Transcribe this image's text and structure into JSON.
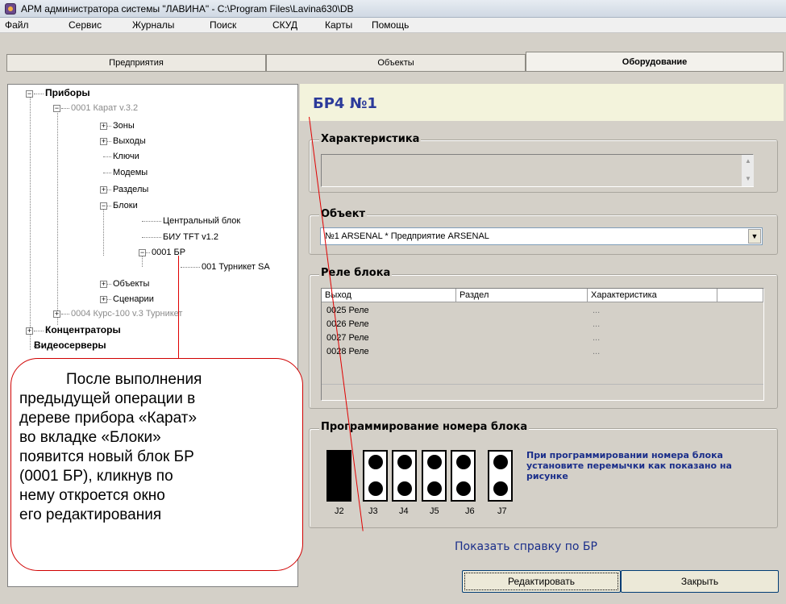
{
  "window": {
    "title": "АРМ администратора системы \"ЛАВИНА\" - C:\\Program Files\\Lavina630\\DB"
  },
  "menu": [
    "Файл",
    "Сервис",
    "Журналы",
    "Поиск",
    "СКУД",
    "Карты",
    "Помощь"
  ],
  "tabs": [
    {
      "label": "Предприятия",
      "active": false
    },
    {
      "label": "Объекты",
      "active": false
    },
    {
      "label": "Оборудование",
      "active": true
    }
  ],
  "tree": {
    "devices": "Приборы",
    "karat": "0001 Карат v.3.2",
    "zones": "Зоны",
    "outputs": "Выходы",
    "keys": "Ключи",
    "modems": "Модемы",
    "sections": "Разделы",
    "blocks": "Блоки",
    "central_block": "Центральный блок",
    "biu": "БИУ TFT v1.2",
    "br_block": "0001 БР",
    "turnstile": "001 Турникет SA",
    "objects": "Объекты",
    "scenarios": "Сценарии",
    "kurs": "0004 Курс-100 v.3 Турникет",
    "concentrators": "Концентраторы",
    "video_servers": "Видеосерверы"
  },
  "editor": {
    "title": "БР4 №1",
    "characteristic_legend": "Характеристика",
    "characteristic_value": "",
    "object_legend": "Объект",
    "object_value": "№1 ARSENAL * Предприятие ARSENAL",
    "relay_legend": "Реле блока",
    "relay_columns": [
      "Выход",
      "Раздел",
      "Характеристика"
    ],
    "relay_rows": [
      {
        "output": "0025 Реле",
        "section": "",
        "char": "..."
      },
      {
        "output": "0026 Реле",
        "section": "",
        "char": "..."
      },
      {
        "output": "0027 Реле",
        "section": "",
        "char": "..."
      },
      {
        "output": "0028 Реле",
        "section": "",
        "char": "..."
      }
    ],
    "programming_legend": "Программирование номера блока",
    "jumpers": [
      "J2",
      "J3",
      "J4",
      "J5",
      "J6",
      "J7"
    ],
    "hint": "При программировании номера блока установите перемычки как показано на рисунке",
    "help_link": "Показать справку по БР",
    "edit_button": "Редактировать",
    "close_button": "Закрыть"
  },
  "callout": {
    "lines": [
      "После выполнения",
      "предыдущей операции в",
      "дереве прибора «Карат»",
      "во вкладке «Блоки»",
      "появится новый блок БР",
      "(0001 БР), кликнув по",
      "нему откроется окно",
      "его редактирования"
    ]
  },
  "colors": {
    "title_blue": "#2b3a9a",
    "hint_blue": "#1a2e8a",
    "callout_red": "#e00000"
  }
}
